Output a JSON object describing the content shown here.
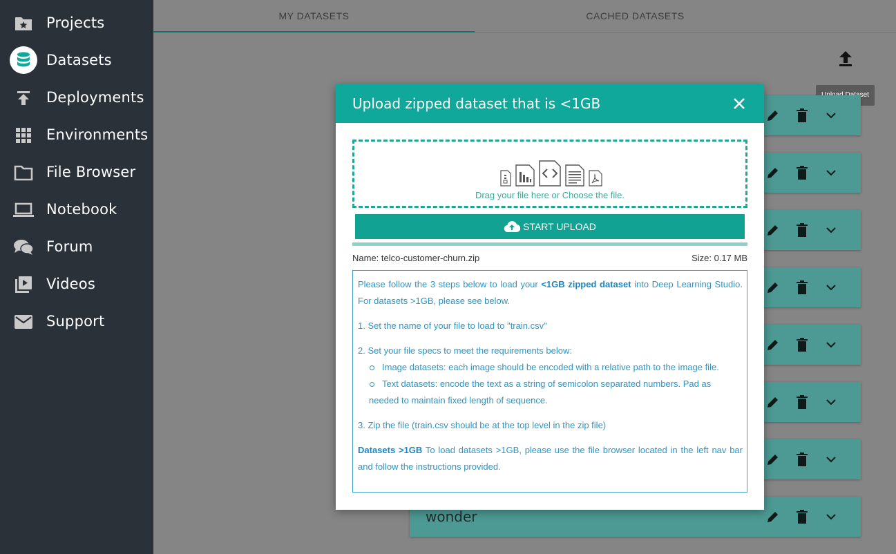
{
  "sidebar": {
    "items": [
      {
        "label": "Projects",
        "icon": "folder-star-icon"
      },
      {
        "label": "Datasets",
        "icon": "database-icon",
        "active": true
      },
      {
        "label": "Deployments",
        "icon": "upload-arrow-icon"
      },
      {
        "label": "Environments",
        "icon": "grid-icon"
      },
      {
        "label": "File Browser",
        "icon": "folder-icon"
      },
      {
        "label": "Notebook",
        "icon": "laptop-icon"
      },
      {
        "label": "Forum",
        "icon": "chat-bubbles-icon"
      },
      {
        "label": "Videos",
        "icon": "video-library-icon"
      },
      {
        "label": "Support",
        "icon": "mail-icon"
      }
    ]
  },
  "tabs": {
    "my_datasets": "MY DATASETS",
    "cached_datasets": "CACHED DATASETS"
  },
  "toolbar": {
    "upload_tooltip": "Upload Dataset"
  },
  "cards": {
    "last_name": "wonder"
  },
  "modal": {
    "title": "Upload zipped dataset that is <1GB",
    "dropzone_text": "Drag your file here or Choose the file.",
    "start_upload": "START UPLOAD",
    "file_name": "Name: telco-customer-churn.zip",
    "file_size": "Size: 0.17 MB",
    "upload_progress": 1.0,
    "instructions": {
      "intro_pre": "Please follow the 3 steps below to load your ",
      "intro_bold": "<1GB zipped dataset",
      "intro_post": " into Deep Learning Studio. For datasets >1GB, please see below.",
      "step1": "1. Set the name of your file to load to \"train.csv\"",
      "step2": "2. Set your file specs to meet the requirements below:",
      "bullet1": "Image datasets: each image should be encoded with a relative path to the image file.",
      "bullet2a": "Text datasets: encode the text as a string of semicolon separated numbers. Pad as",
      "bullet2b": "needed to maintain fixed length of sequence.",
      "step3": "3. Zip the file (train.csv should be at the top level in the zip file)",
      "large_bold": "Datasets >1GB",
      "large_text": " To load datasets >1GB, please use the file browser located in the left nav bar and follow the instructions provided."
    }
  },
  "colors": {
    "sidebar_bg": "#2b3139",
    "accent": "#0fa89a",
    "instructions_text": "#2a96c9"
  }
}
